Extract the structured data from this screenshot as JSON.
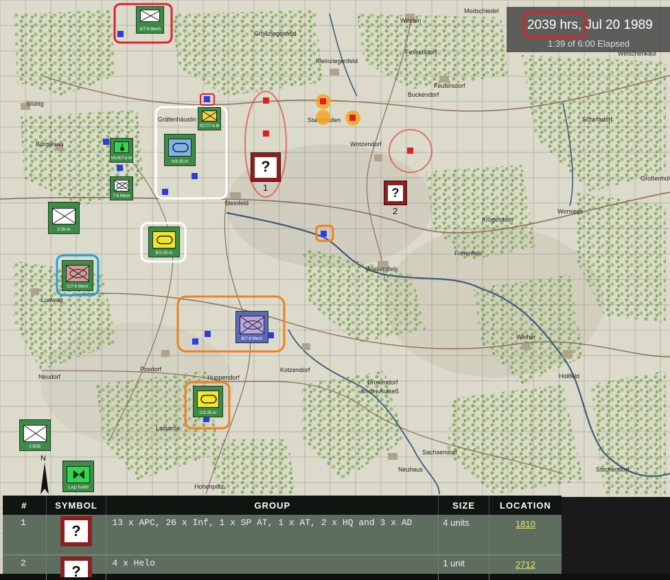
{
  "clock": {
    "time": "2039 hrs, Jul 20 1989",
    "elapsed": "1:39 of 6:00 Elapsed"
  },
  "towns": [
    "Modschiedel",
    "Weiden",
    "Großziegenfeld",
    "Fesselsdorf",
    "Welschenkaul",
    "Kleinziegenfeld",
    "Feulersdorf",
    "Buckendorf",
    "Stübig",
    "Gräfenhäuslin",
    "Stadelhofen",
    "Schirradorf",
    "Burglesau",
    "Wotzendorf",
    "Großenhül",
    "Steinfeld",
    "Wonsees",
    "Krögelstein",
    "Freienfels",
    "Wiesentfels",
    "Ludwag",
    "Weiher",
    "Neudorf",
    "Poxdorf",
    "Huppendorf",
    "Kotzendorf",
    "Hollfeld",
    "Drosendorf",
    "an der Aufseß",
    "Laibarös",
    "Sachsendorf",
    "Neuhaus",
    "Stechendorf",
    "Hohenpölz"
  ],
  "units": [
    {
      "label": "A/7-6 Mech",
      "type": "mech"
    },
    {
      "label": "SCT/7-6 M",
      "type": "scout"
    },
    {
      "label": "M1/6/7-6 M",
      "type": "mortar"
    },
    {
      "label": "7-6 Mech",
      "type": "mech"
    },
    {
      "label": "A/3-35 Ar",
      "type": "armor"
    },
    {
      "label": "3-35 Ar",
      "type": "mech"
    },
    {
      "label": "B/3-35 Ar",
      "type": "armor"
    },
    {
      "label": "C/7-6 Mech",
      "type": "mech"
    },
    {
      "label": "B/7-6 Mech",
      "type": "mech"
    },
    {
      "label": "C/3-35 Ar",
      "type": "armor"
    },
    {
      "label": "3 BDE",
      "type": "hq"
    },
    {
      "label": "1 AD FARP",
      "type": "farp"
    }
  ],
  "enemy_markers": [
    {
      "label": "1"
    },
    {
      "label": "2"
    }
  ],
  "table": {
    "headers": [
      "#",
      "SYMBOL",
      "GROUP",
      "SIZE",
      "LOCATION"
    ],
    "rows": [
      {
        "num": "1",
        "symbol": "?",
        "group": "13 x APC, 26 x Inf, 1 x SP AT, 1 x AT, 2 x HQ and 3 x AD",
        "size": "4 units",
        "location": "1810"
      },
      {
        "num": "2",
        "symbol": "?",
        "group": "4 x Helo",
        "size": "1 unit",
        "location": "2712"
      }
    ]
  },
  "colors": {
    "friendly": "#3e8a48",
    "enemy": "#8c2020",
    "highlight_red": "#e0202a",
    "highlight_orange": "#f08020",
    "highlight_white": "#ffffff",
    "highlight_blue": "#20a0e0",
    "contact": "#2d3de0"
  }
}
